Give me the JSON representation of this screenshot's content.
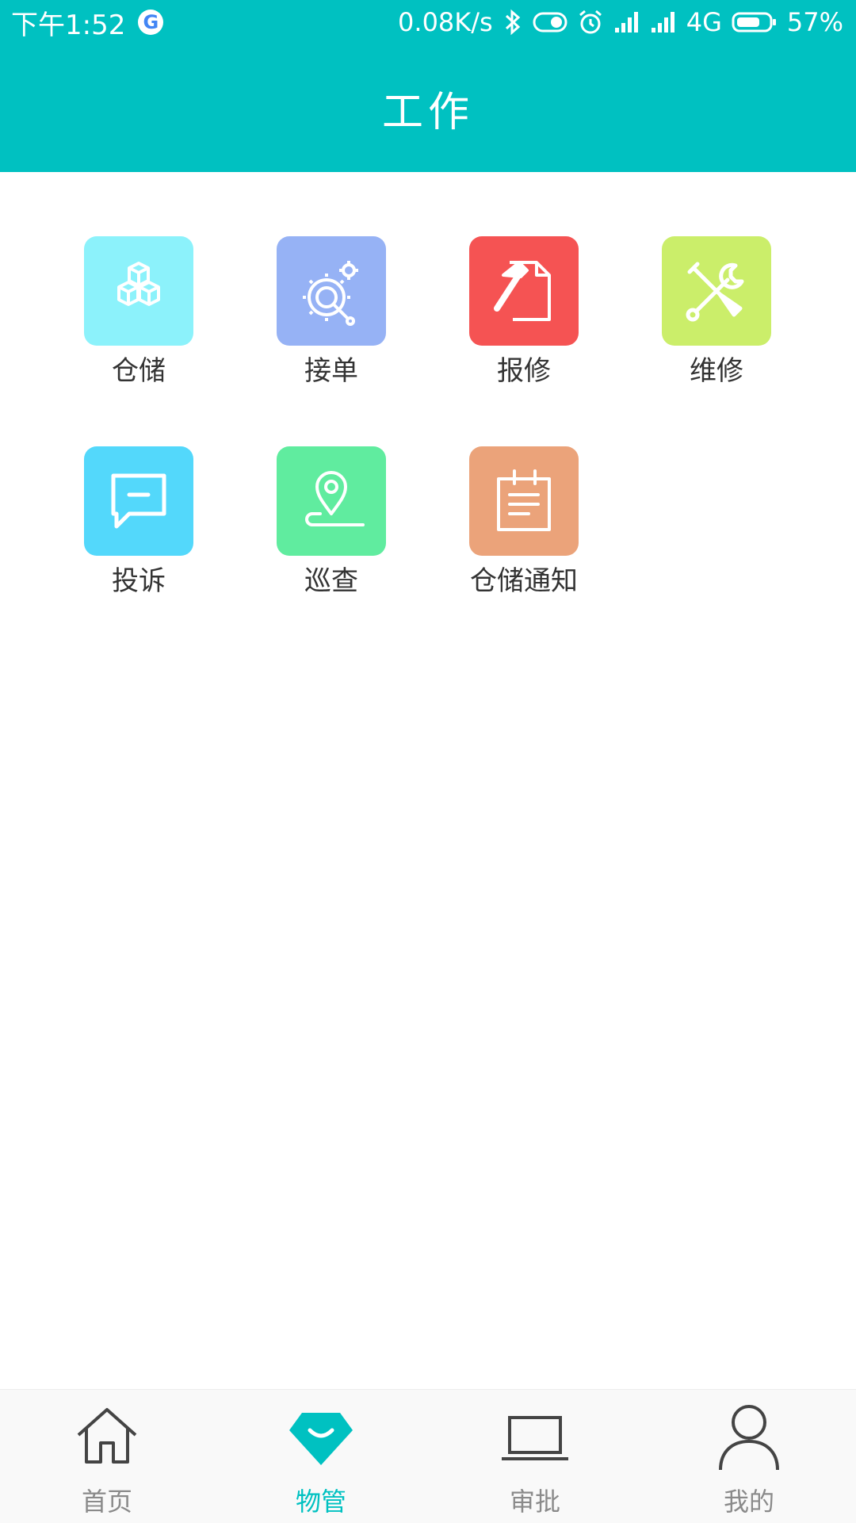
{
  "status_bar": {
    "time": "下午1:52",
    "network_speed": "0.08K/s",
    "network_type": "4G",
    "battery": "57%",
    "icons": [
      "google-icon",
      "bluetooth-icon",
      "toggle-icon",
      "alarm-icon",
      "signal-icon",
      "signal-icon",
      "battery-icon"
    ]
  },
  "header": {
    "title": "工作"
  },
  "grid": {
    "items": [
      {
        "label": "仓储",
        "icon": "boxes-icon",
        "color": "#8cf2fb"
      },
      {
        "label": "接单",
        "icon": "gear-wrench-icon",
        "color": "#96b2f5"
      },
      {
        "label": "报修",
        "icon": "hammer-document-icon",
        "color": "#f55353"
      },
      {
        "label": "维修",
        "icon": "tools-icon",
        "color": "#cbee6a"
      },
      {
        "label": "投诉",
        "icon": "chat-bubble-icon",
        "color": "#53d8fb"
      },
      {
        "label": "巡查",
        "icon": "location-pin-icon",
        "color": "#60ec9f"
      },
      {
        "label": "仓储通知",
        "icon": "notice-board-icon",
        "color": "#eba37a"
      }
    ]
  },
  "tabbar": {
    "items": [
      {
        "label": "首页",
        "icon": "home-icon",
        "active": false
      },
      {
        "label": "物管",
        "icon": "diamond-icon",
        "active": true
      },
      {
        "label": "审批",
        "icon": "laptop-icon",
        "active": false
      },
      {
        "label": "我的",
        "icon": "user-icon",
        "active": false
      }
    ],
    "active_color": "#00c1c1",
    "inactive_color": "#8a8a8a"
  }
}
